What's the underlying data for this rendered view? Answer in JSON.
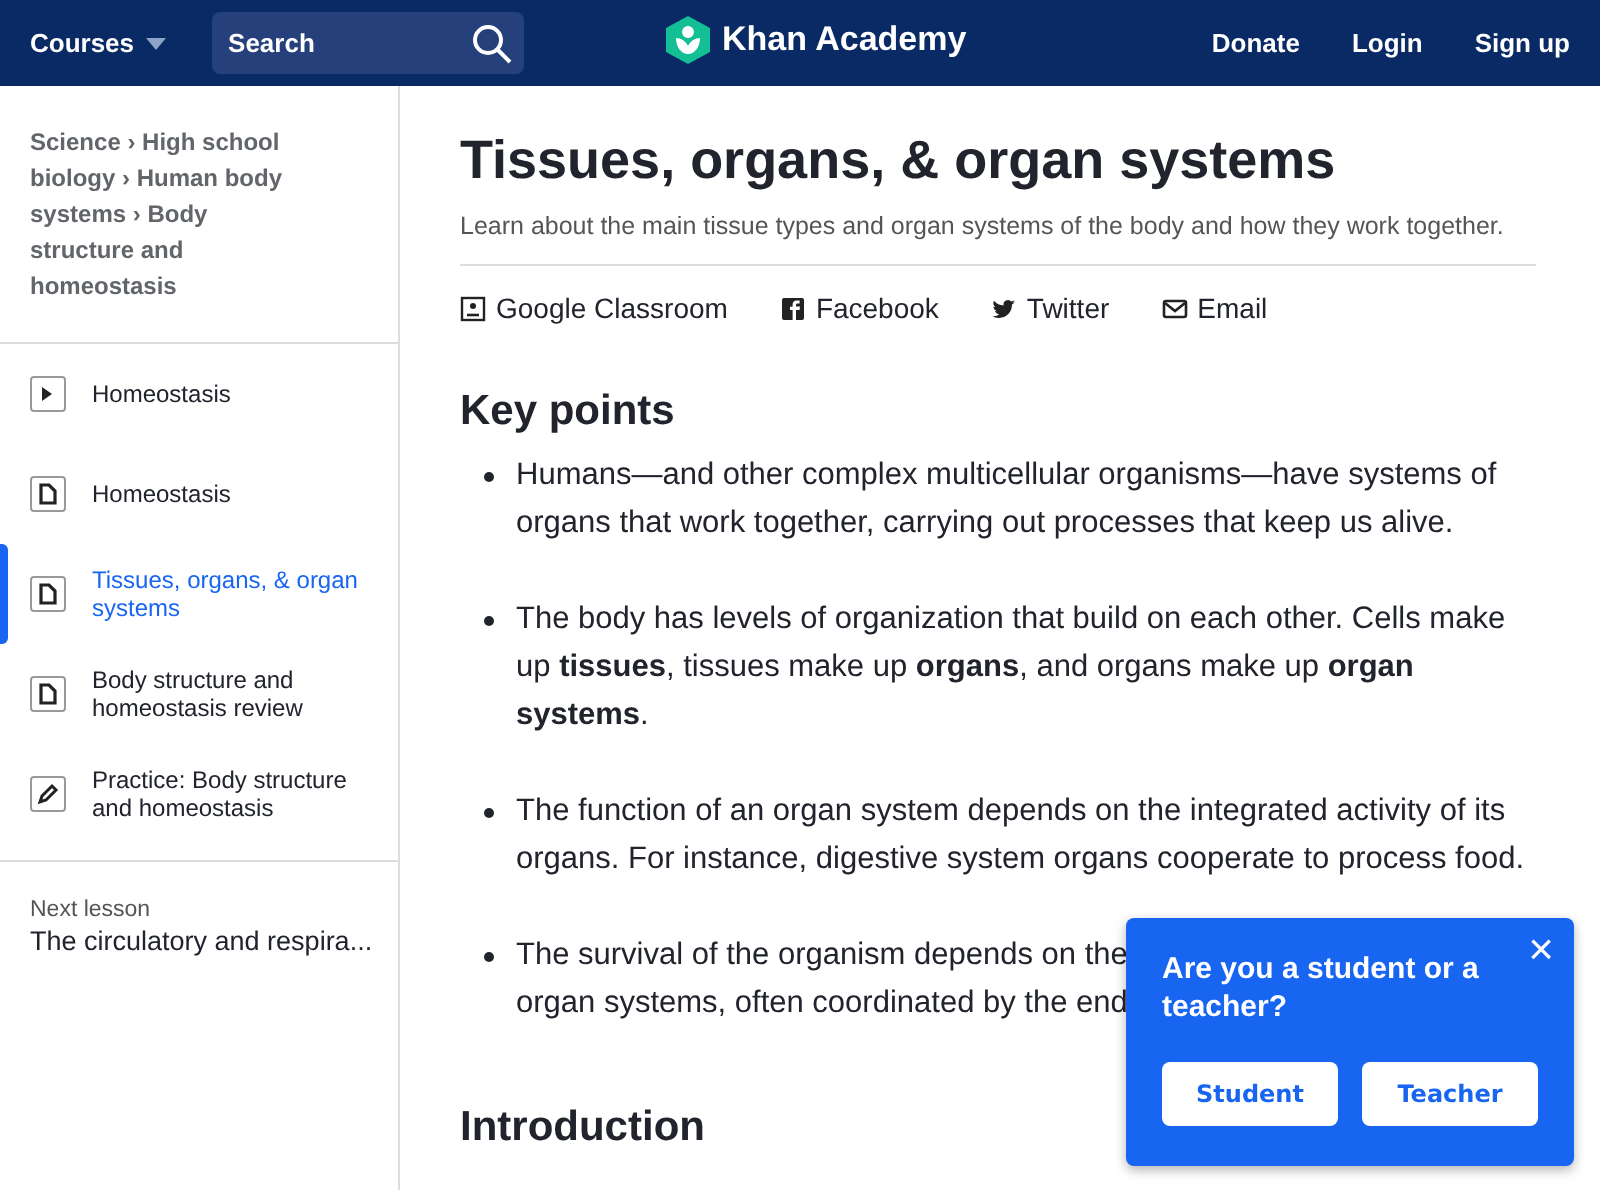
{
  "header": {
    "courses": "Courses",
    "search": {
      "placeholder": "Search"
    },
    "logo": "Khan Academy",
    "links": [
      "Donate",
      "Login",
      "Sign up"
    ]
  },
  "sidebar": {
    "breadcrumbs": [
      "Science",
      "High school biology",
      "Human body systems",
      "Body structure and homeostasis"
    ],
    "breadcrumb_separator": "›",
    "items": [
      {
        "kind": "video",
        "label": "Homeostasis",
        "selected": false
      },
      {
        "kind": "article",
        "label": "Homeostasis",
        "selected": false
      },
      {
        "kind": "article",
        "label": "Tissues, organs, & organ systems",
        "selected": true
      },
      {
        "kind": "article",
        "label": "Body structure and homeostasis review",
        "selected": false
      },
      {
        "kind": "exercise",
        "label": "Practice: Body structure and homeostasis",
        "selected": false
      }
    ],
    "next_lesson": {
      "label": "Next lesson",
      "title": "The circulatory and respira..."
    }
  },
  "article": {
    "title": "Tissues, organs, & organ systems",
    "subtitle": "Learn about the main tissue types and organ systems of the body and how they work together.",
    "share": [
      {
        "kind": "classroom",
        "label": "Google Classroom"
      },
      {
        "kind": "facebook",
        "label": "Facebook"
      },
      {
        "kind": "twitter",
        "label": "Twitter"
      },
      {
        "kind": "email",
        "label": "Email"
      }
    ],
    "heading": "Key points",
    "points": [
      "Humans—and other complex multicellular organisms—have systems of organs that work together, carrying out processes that keep us alive.",
      "The body has levels of organization that build on each other. Cells make up **tissues**, tissues make up **organs**, and organs make up **organ systems**.",
      "The function of an organ system depends on the integrated activity of its organs. For instance, digestive system organs cooperate to process food.",
      "The survival of the organism depends on the\norgan systems, often coordinated by the end"
    ],
    "heading_2": "Introduction"
  },
  "popup": {
    "question": "Are you a student or a teacher?",
    "close": "×",
    "buttons": [
      "Student",
      "Teacher"
    ]
  }
}
